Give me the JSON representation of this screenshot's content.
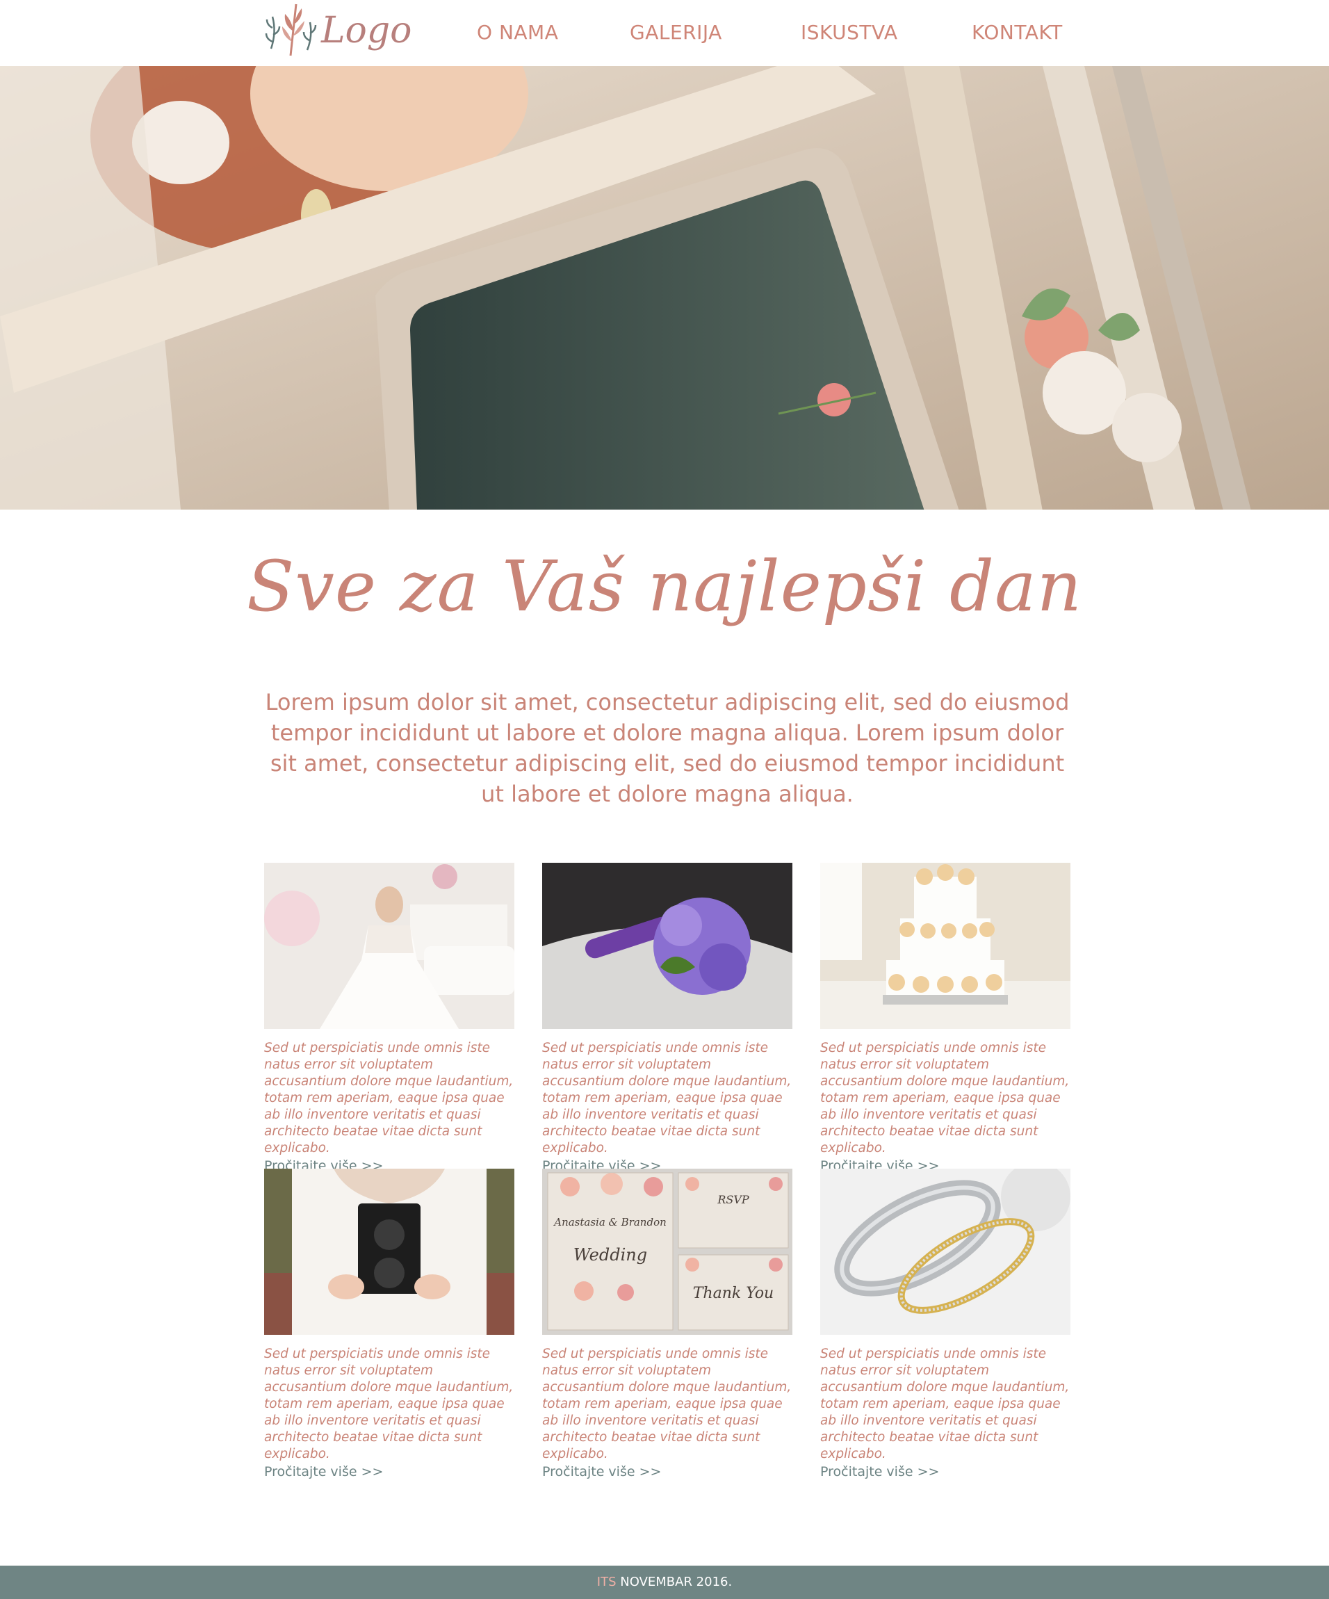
{
  "header": {
    "logo_text": "Logo",
    "nav": [
      "O NAMA",
      "GALERIJA",
      "ISKUSTVA",
      "KONTAKT"
    ]
  },
  "hero": {
    "image": "bride-in-vintage-car"
  },
  "headline": "Sve za Vaš  najlepši dan",
  "intro": "Lorem ipsum dolor sit amet, consectetur adipiscing elit, sed do eiusmod tempor incididunt ut labore et dolore magna aliqua. Lorem ipsum dolor sit amet, consectetur adipiscing elit, sed do eiusmod tempor incididunt ut labore et dolore magna aliqua.",
  "cards": [
    {
      "image": "bride-dress",
      "text": "Sed ut perspiciatis unde omnis iste natus error sit voluptatem accusantium dolore mque laudantium, totam rem aperiam, eaque ipsa quae ab illo inventore veritatis et quasi architecto beatae vitae dicta sunt explicabo.",
      "more": "Pročitajte više >>"
    },
    {
      "image": "purple-bouquet",
      "text": "Sed ut perspiciatis unde omnis iste natus error sit voluptatem accusantium dolore mque laudantium, totam rem aperiam, eaque ipsa quae ab illo inventore veritatis et quasi architecto beatae vitae dicta sunt explicabo.",
      "more": "Pročitajte više >>"
    },
    {
      "image": "wedding-cake",
      "text": "Sed ut perspiciatis unde omnis iste natus error sit voluptatem accusantium dolore mque laudantium, totam rem aperiam, eaque ipsa quae ab illo inventore veritatis et quasi architecto beatae vitae dicta sunt explicabo.",
      "more": "Pročitajte više >>"
    },
    {
      "image": "bride-camera",
      "text": "Sed ut perspiciatis unde omnis iste natus error sit voluptatem accusantium dolore mque laudantium, totam rem aperiam, eaque ipsa quae ab illo inventore veritatis et quasi architecto beatae vitae dicta sunt explicabo.",
      "more": "Pročitajte više >>"
    },
    {
      "image": "wedding-invitations",
      "text": "Sed ut perspiciatis unde omnis iste natus error sit voluptatem accusantium dolore mque laudantium, totam rem aperiam, eaque ipsa quae ab illo inventore veritatis et quasi architecto beatae vitae dicta sunt explicabo.",
      "more": "Pročitajte više >>"
    },
    {
      "image": "wedding-rings",
      "text": "Sed ut perspiciatis unde omnis iste natus error sit voluptatem accusantium dolore mque laudantium, totam rem aperiam, eaque ipsa quae ab illo inventore veritatis et quasi architecto beatae vitae dicta sunt explicabo.",
      "more": "Pročitajte više >>"
    }
  ],
  "invitation_art": {
    "names": "Anastasia & Brandon",
    "word": "Wedding",
    "rsvp": "RSVP",
    "thank_you": "Thank You"
  },
  "footer": {
    "its": "ITS",
    "date": "NOVEMBAR 2016."
  },
  "colors": {
    "accent": "#c98477",
    "nav": "#cf8577",
    "link": "#6c8383",
    "footer_bg": "#6f8584"
  }
}
